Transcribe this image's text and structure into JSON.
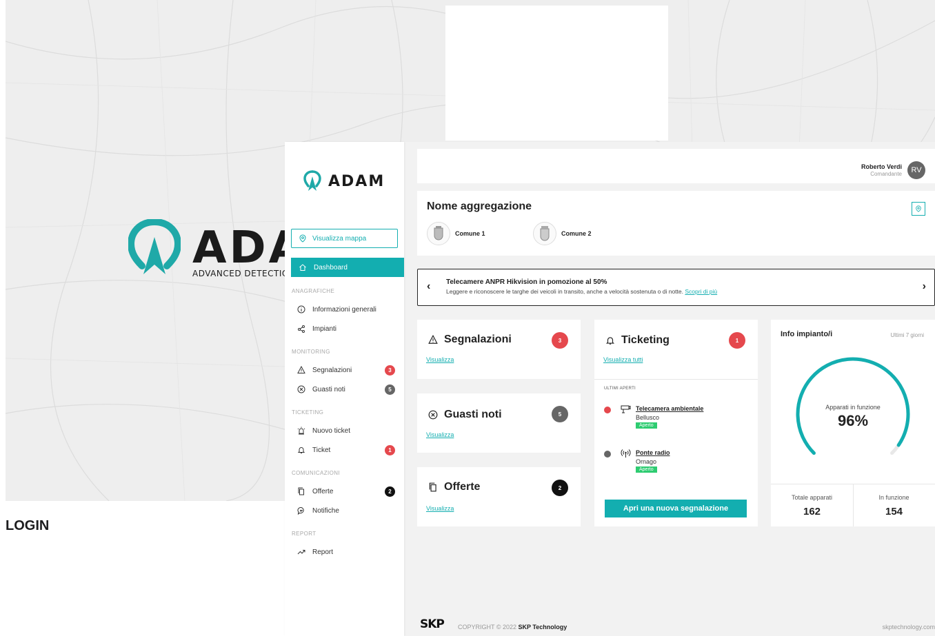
{
  "login": {
    "brand": "ADAM",
    "tagline": "ADVANCED DETECTION ADMINISTRATION M",
    "label": "LOGIN"
  },
  "sidebar": {
    "brand": "ADAM",
    "map_button": "Visualizza mappa",
    "dashboard": "Dashboard",
    "sections": {
      "anagrafiche": "ANAGRAFICHE",
      "monitoring": "MONITORING",
      "ticketing": "TICKETING",
      "comunicazioni": "COMUNICAZIONI",
      "report": "REPORT"
    },
    "items": {
      "informazioni": "Informazioni generali",
      "impianti": "Impianti",
      "segnalazioni": "Segnalazioni",
      "segnalazioni_count": "3",
      "guasti": "Guasti noti",
      "guasti_count": "5",
      "nuovo_ticket": "Nuovo ticket",
      "ticket": "Ticket",
      "ticket_count": "1",
      "offerte": "Offerte",
      "offerte_count": "2",
      "notifiche": "Notifiche",
      "report": "Report"
    }
  },
  "header": {
    "user_name": "Roberto Verdi",
    "user_role": "Comandante",
    "avatar_initials": "RV"
  },
  "aggregation": {
    "title": "Nome aggregazione",
    "comuni": [
      "Comune 1",
      "Comune 2"
    ]
  },
  "promo": {
    "title": "Telecamere ANPR Hikvision in pomozione al 50%",
    "text": "Leggere e riconoscere le targhe dei veicoli in transito, anche a velocità sostenuta o di notte.",
    "link": "Scopri di più"
  },
  "cards": {
    "segnalazioni": {
      "title": "Segnalazioni",
      "count": "3",
      "link": "Visualizza"
    },
    "guasti": {
      "title": "Guasti noti",
      "count": "5",
      "link": "Visualizza"
    },
    "offerte": {
      "title": "Offerte",
      "count": "2",
      "link": "Visualizza"
    },
    "ticketing": {
      "title": "Ticketing",
      "count": "1",
      "link": "Visualizza tutti",
      "recent_label": "ULTIMI APERTI",
      "items": [
        {
          "name": "Telecamera ambientale",
          "place": "Bellusco",
          "status": "Aperto"
        },
        {
          "name": "Ponte radio",
          "place": "Ornago",
          "status": "Aperto"
        }
      ],
      "button": "Apri una nuova segnalazione"
    },
    "info": {
      "title": "Info impianto/i",
      "period": "Ultimi 7 giorni",
      "gauge_label": "Apparati in funzione",
      "gauge_value": "96%",
      "gauge_fraction": 0.96,
      "total_label": "Totale apparati",
      "total_value": "162",
      "working_label": "In funzione",
      "working_value": "154"
    }
  },
  "footer": {
    "logo": "SKP",
    "copyright": "COPYRIGHT © 2022",
    "company": "SKP Technology",
    "site": "skptechnology.com"
  },
  "colors": {
    "accent": "#13aeb0",
    "danger": "#e5484d",
    "neutral_badge": "#666666",
    "dark_badge": "#111111",
    "status_open": "#2ecc71"
  }
}
